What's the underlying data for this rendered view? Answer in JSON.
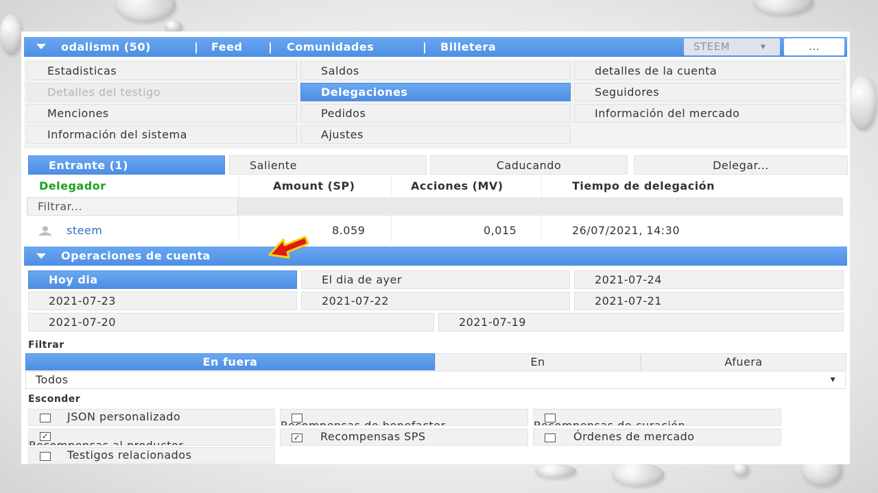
{
  "colors": {
    "accent": "#5a9ae8",
    "delegator_header": "#1aa21a",
    "link": "#2f6fc4"
  },
  "topbar": {
    "user": "odalismn (50)",
    "nav": [
      "Feed",
      "Comunidades",
      "Billetera"
    ],
    "separator": "|",
    "currency": "STEEM",
    "more": "..."
  },
  "menu": {
    "col1": [
      "Estadisticas",
      "Detalles del testigo",
      "Menciones",
      "Información del sistema"
    ],
    "col2": [
      "Saldos",
      "Delegaciones",
      "Pedidos",
      "Ajustes"
    ],
    "col3": [
      "detalles de la cuenta",
      "Seguidores",
      "Información del mercado"
    ],
    "active": "Delegaciones",
    "disabled": "Detalles del testigo"
  },
  "delegation_tabs": [
    "Entrante (1)",
    "Saliente",
    "Caducando",
    "Delegar..."
  ],
  "table": {
    "headers": [
      "Delegador",
      "Amount (SP)",
      "Acciones (MV)",
      "Tiempo de delegación"
    ],
    "filter_placeholder": "Filtrar...",
    "rows": [
      {
        "delegator": "steem",
        "amount": "8.059",
        "actions": "0,015",
        "time": "26/07/2021, 14:30"
      }
    ]
  },
  "operations": {
    "title": "Operaciones de cuenta",
    "dates_row1": [
      "Hoy dia",
      "El dia de ayer",
      "2021-07-24"
    ],
    "dates_row2": [
      "2021-07-23",
      "2021-07-22",
      "2021-07-21"
    ],
    "dates_row3": [
      "2021-07-20",
      "2021-07-19"
    ],
    "filter_label": "Filtrar",
    "direction": [
      "En fuera",
      "En",
      "Afuera"
    ],
    "select_value": "Todos",
    "hide_label": "Esconder",
    "hide_options": [
      {
        "label": "JSON personalizado",
        "checked": false
      },
      {
        "label": "Recompensas de benefactor",
        "checked": false
      },
      {
        "label": "Recompensas de curación",
        "checked": false
      },
      {
        "label": "Recompensas al productor",
        "checked": true
      },
      {
        "label": "Recompensas SPS",
        "checked": true
      },
      {
        "label": "Órdenes de mercado",
        "checked": false
      },
      {
        "label": "Testigos relacionados",
        "checked": false
      }
    ]
  }
}
